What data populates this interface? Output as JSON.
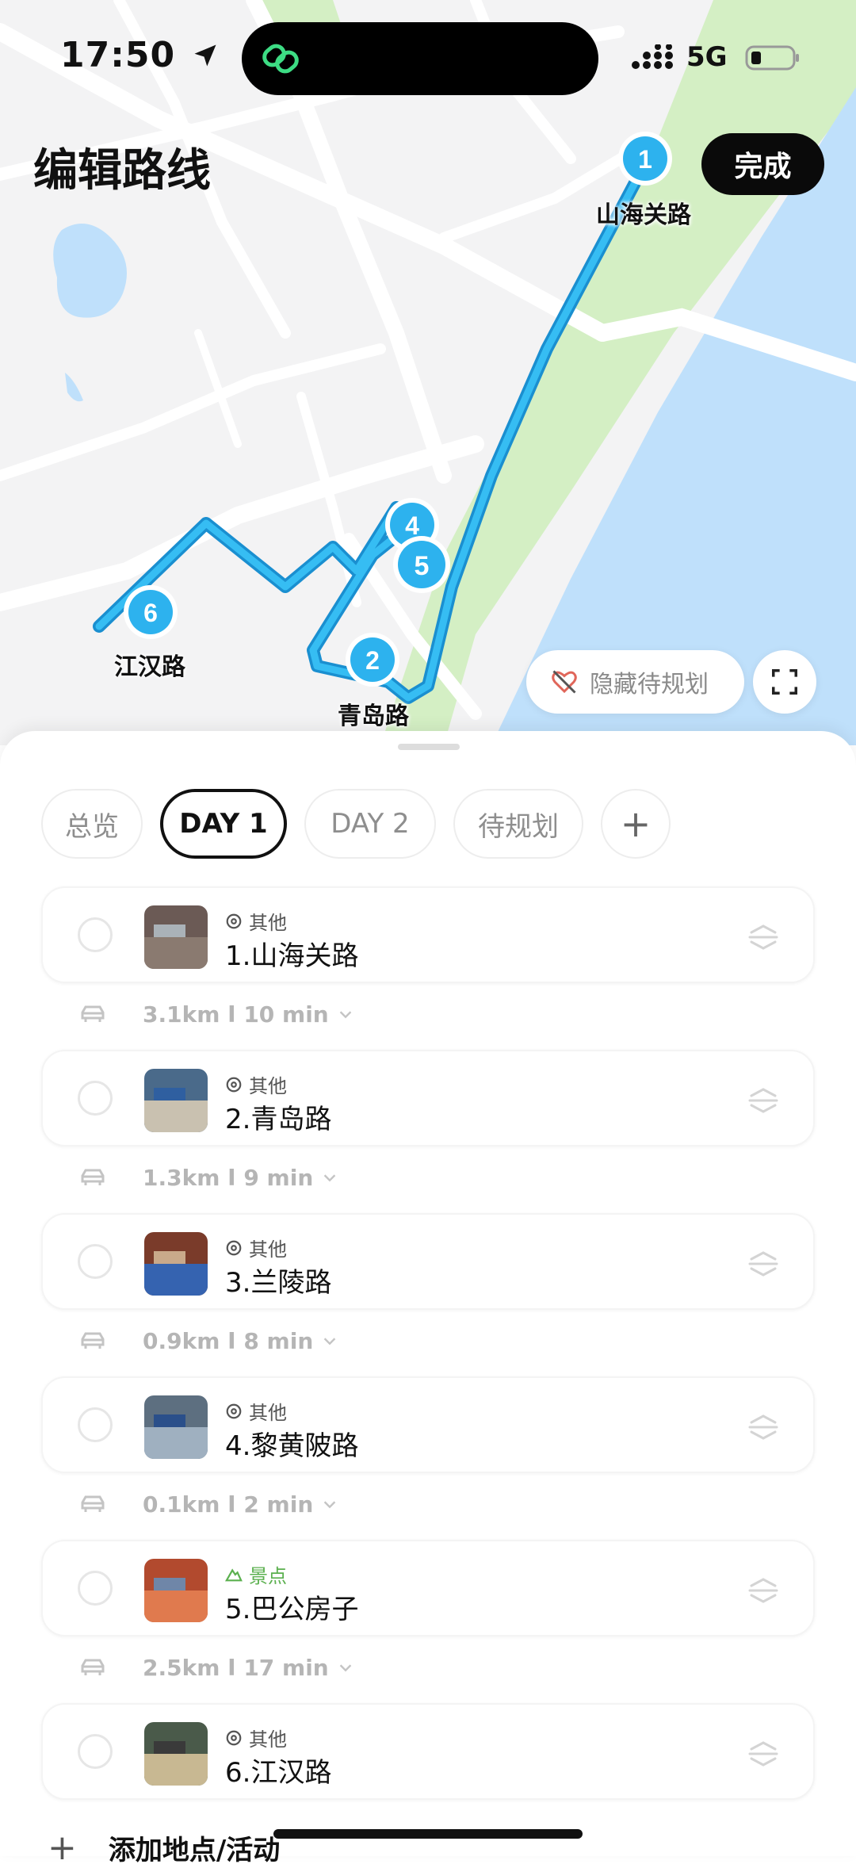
{
  "status_bar": {
    "time": "17:50",
    "network": "5G"
  },
  "header": {
    "title": "编辑路线",
    "done_label": "完成"
  },
  "map": {
    "hide_pending_label": "隐藏待规划",
    "pins": [
      {
        "number": "1",
        "label": "山海关路"
      },
      {
        "number": "2",
        "label": "青岛路"
      },
      {
        "number": "4",
        "label": ""
      },
      {
        "number": "5",
        "label": ""
      },
      {
        "number": "6",
        "label": "江汉路"
      }
    ]
  },
  "tabs": [
    {
      "label": "总览",
      "active": false
    },
    {
      "label": "DAY 1",
      "active": true
    },
    {
      "label": "DAY 2",
      "active": false
    },
    {
      "label": "待规划",
      "active": false
    },
    {
      "label": "+",
      "active": false
    }
  ],
  "stops": [
    {
      "category": "其他",
      "name": "1.山海关路",
      "icon": "location-pin-icon"
    },
    {
      "category": "其他",
      "name": "2.青岛路",
      "icon": "location-pin-icon"
    },
    {
      "category": "其他",
      "name": "3.兰陵路",
      "icon": "location-pin-icon"
    },
    {
      "category": "其他",
      "name": "4.黎黄陂路",
      "icon": "location-pin-icon"
    },
    {
      "category": "景点",
      "name": "5.巴公房子",
      "icon": "mountain-icon"
    },
    {
      "category": "其他",
      "name": "6.江汉路",
      "icon": "location-pin-icon"
    }
  ],
  "legs": [
    {
      "text": "3.1km Ι 10 min"
    },
    {
      "text": "1.3km Ι 9 min"
    },
    {
      "text": "0.9km Ι 8 min"
    },
    {
      "text": "0.1km Ι 2 min"
    },
    {
      "text": "2.5km Ι 17 min"
    }
  ],
  "add_label": "添加地点/活动",
  "colors": {
    "route": "#2db2ee",
    "water": "#bfe0fb",
    "park": "#d4efc4",
    "scenic": "#5bb04f"
  }
}
